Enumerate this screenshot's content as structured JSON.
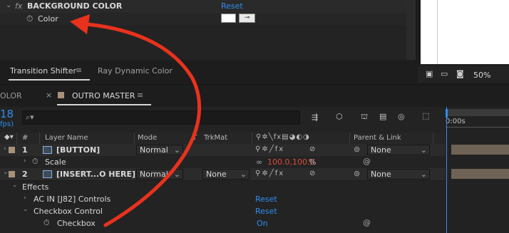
{
  "effect_controls": {
    "effect_name": "BACKGROUND COLOR",
    "fx_label": "fx",
    "reset": "Reset",
    "color_label": "Color",
    "color_value": "#ffffff"
  },
  "panel_tabs": {
    "transition_shifter": "Transition Shifter",
    "ray_dynamic_color": "Ray Dynamic Color"
  },
  "viewer": {
    "zoom": "50%"
  },
  "timeline": {
    "prev_tab": "OLOR",
    "comp_tab": "OUTRO MASTER",
    "timecode": "18",
    "fps": "fps)",
    "search_placeholder": "",
    "ruler_time": "0:00s",
    "columns": {
      "hash": "#",
      "layer_name": "Layer Name",
      "mode": "Mode",
      "t": "T",
      "trkmat": "TrkMat",
      "parent_link": "Parent & Link"
    },
    "layers": [
      {
        "num": "1",
        "name": "[BUTTON]",
        "mode": "Normal",
        "trkmat": "",
        "parent": "None",
        "swatch": "#a8927a"
      },
      {
        "num": "2",
        "name": "[INSERT...O HERE]",
        "mode": "Normal",
        "trkmat": "None",
        "parent": "None",
        "swatch": "#a8927a"
      }
    ],
    "scale_label": "Scale",
    "scale_value": "100.0,100.0",
    "scale_unit": "%",
    "effects_label": "Effects",
    "effect1": "AC IN [J82] Controls",
    "effect2": "Checkbox Control",
    "checkbox_label": "Checkbox",
    "checkbox_value": "On",
    "reset1": "Reset",
    "reset2": "Reset"
  },
  "colors": {
    "accent_blue": "#2f8cf0",
    "value_red": "#e04a3a",
    "annotation_arrow": "#e8321d"
  }
}
